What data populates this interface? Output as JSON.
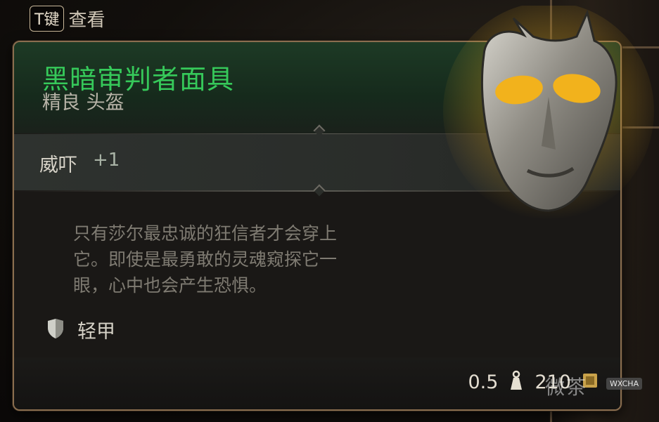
{
  "hint": {
    "key": "T键",
    "label": "查看"
  },
  "item": {
    "name": "黑暗审判者面具",
    "rarity_type": "精良 头盔",
    "name_color": "#36c95a"
  },
  "stat": {
    "name": "威吓",
    "value": "+1"
  },
  "description": [
    "只有莎尔最忠诚的狂信者才会穿上",
    "它。即使是最勇敢的灵魂窥探它一",
    "眼，心中也会产生恐惧。"
  ],
  "armor": {
    "icon": "shield-icon",
    "label": "轻甲"
  },
  "footer": {
    "weight": "0.5",
    "weight_icon": "weight-icon",
    "value": "210",
    "value_icon": "coin-icon"
  },
  "watermark": {
    "text": "微茶",
    "tag": "WXCHA"
  }
}
